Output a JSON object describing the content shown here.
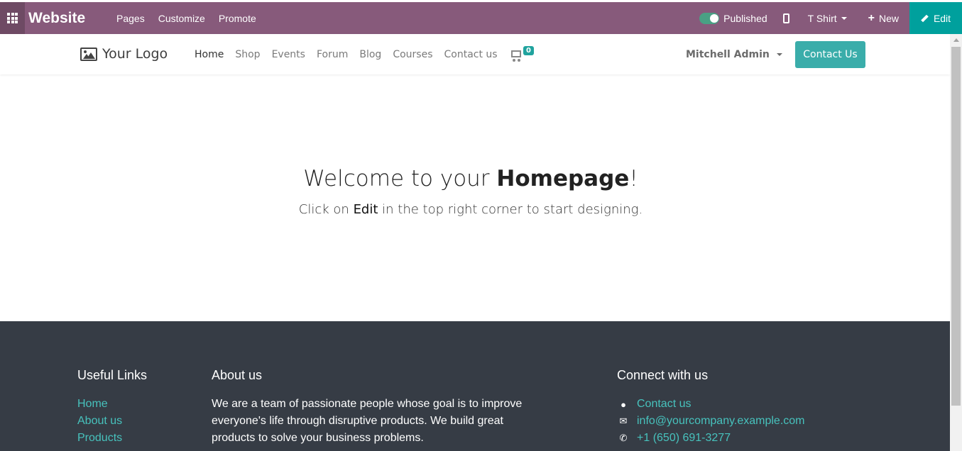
{
  "topbar": {
    "brand": "Website",
    "menu": [
      "Pages",
      "Customize",
      "Promote"
    ],
    "published_label": "Published",
    "published": true,
    "page_dropdown": "T Shirt",
    "new_label": "New",
    "edit_label": "Edit"
  },
  "navbar": {
    "logo_text": "Your Logo",
    "links": [
      "Home",
      "Shop",
      "Events",
      "Forum",
      "Blog",
      "Courses",
      "Contact us"
    ],
    "active_link": "Home",
    "cart_count": "0",
    "user": "Mitchell Admin",
    "contact_button": "Contact Us"
  },
  "hero": {
    "title_pre": "Welcome to your ",
    "title_bold": "Homepage",
    "title_post": "!",
    "sub_pre": "Click on ",
    "sub_bold": "Edit",
    "sub_post": " in the top right corner to start designing."
  },
  "footer": {
    "useful_links_title": "Useful Links",
    "useful_links": [
      "Home",
      "About us",
      "Products"
    ],
    "about_title": "About us",
    "about_text": "We are a team of passionate people whose goal is to improve everyone's life through disruptive products. We build great products to solve your business problems.",
    "connect_title": "Connect with us",
    "connect": {
      "contact": "Contact us",
      "email": "info@yourcompany.example.com",
      "phone": "+1 (650) 691-3277"
    }
  },
  "colors": {
    "admin_bar": "#875a7b",
    "edit_button": "#00a09d",
    "accent": "#3aadaa",
    "footer_bg": "#363c45",
    "footer_link": "#47c2bd"
  }
}
